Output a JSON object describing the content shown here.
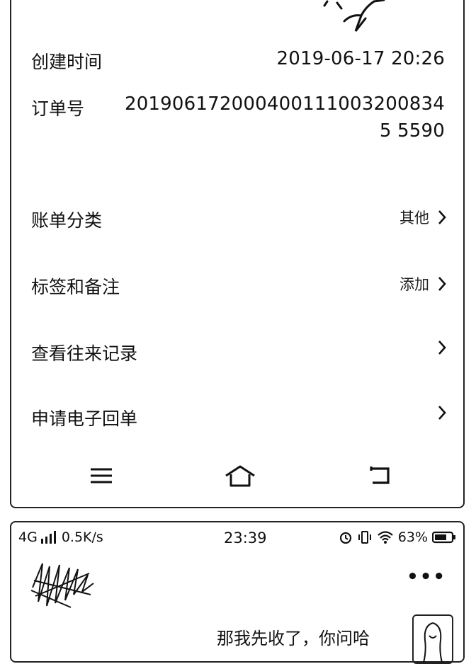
{
  "detail": {
    "created_label": "创建时间",
    "created_value": "2019-06-17 20:26",
    "order_label": "订单号",
    "order_value": "2019061720004001110032008345 5590",
    "menu": [
      {
        "label": "账单分类",
        "value": "其他"
      },
      {
        "label": "标签和备注",
        "value": "添加"
      },
      {
        "label": "查看往来记录",
        "value": ""
      },
      {
        "label": "申请电子回单",
        "value": ""
      }
    ]
  },
  "status_bar": {
    "network": "4G",
    "speed": "0.5K/s",
    "time": "23:39",
    "battery": "63%"
  },
  "chat": {
    "more_label": "•••",
    "message": "那我先收了，你问哈"
  }
}
